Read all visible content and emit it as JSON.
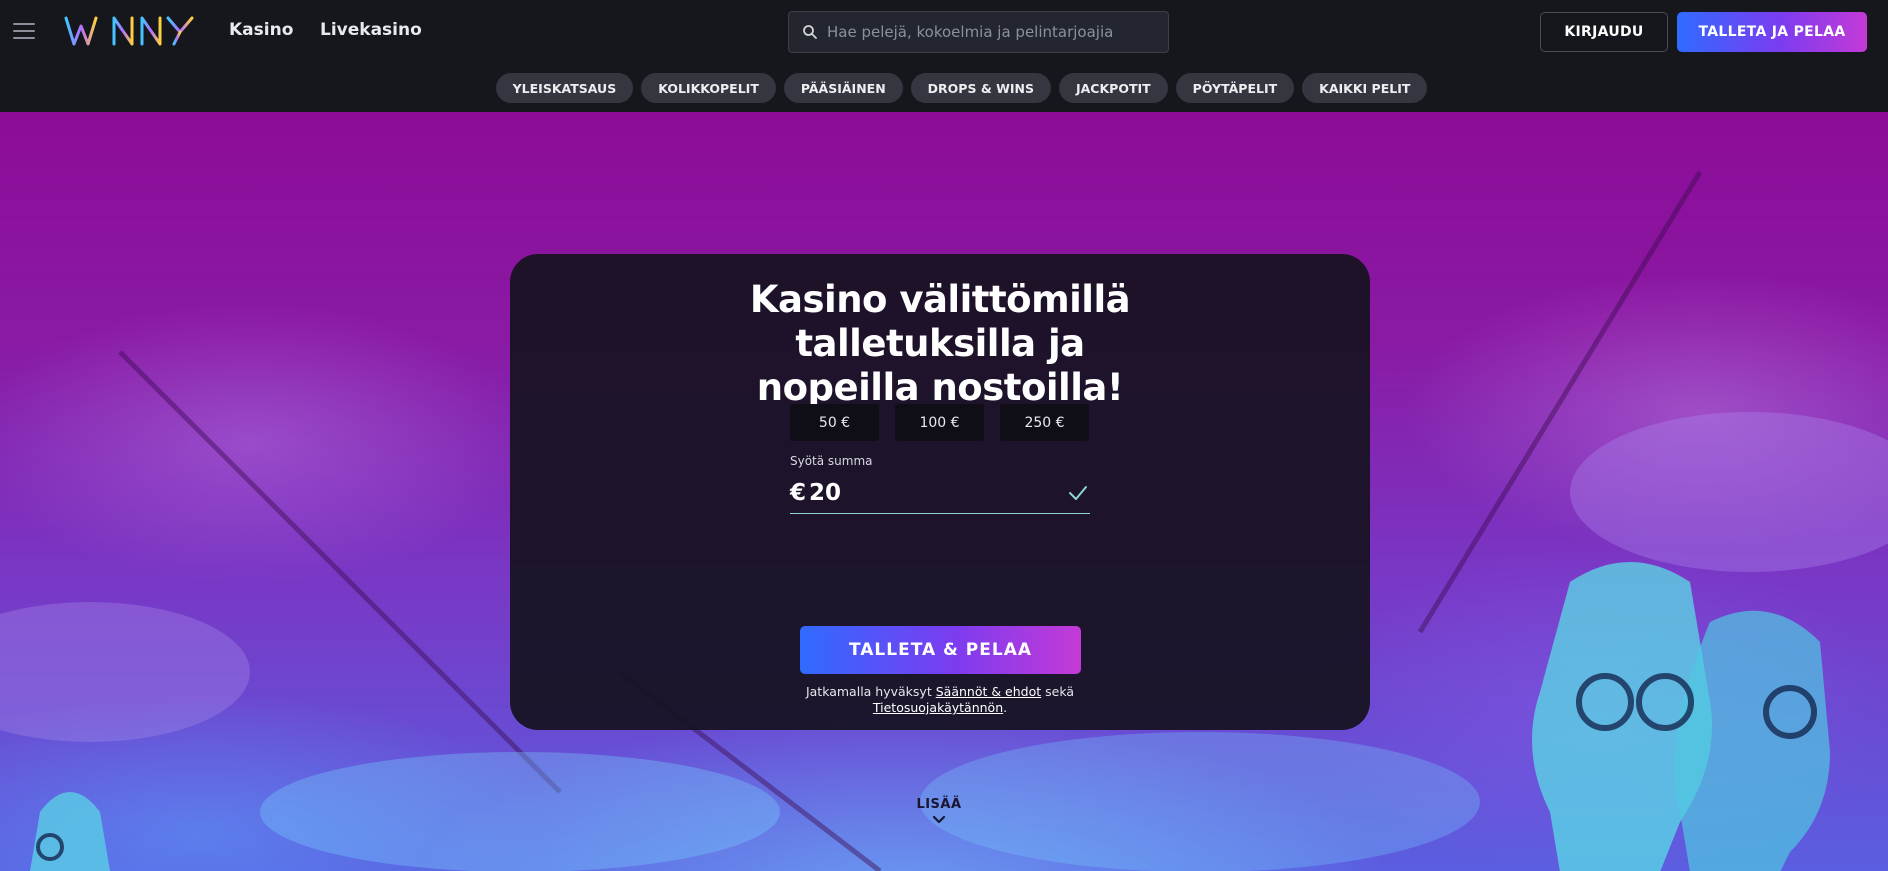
{
  "header": {
    "logo_text": "WINNY",
    "nav": [
      {
        "label": "Kasino"
      },
      {
        "label": "Livekasino"
      }
    ],
    "search": {
      "placeholder": "Hae pelejä, kokoelmia ja pelintarjoajia",
      "value": ""
    },
    "login_label": "KIRJAUDU",
    "deposit_label": "TALLETA JA PELAA"
  },
  "categories": [
    {
      "label": "YLEISKATSAUS"
    },
    {
      "label": "KOLIKKOPELIT"
    },
    {
      "label": "PÄÄSIÄINEN"
    },
    {
      "label": "DROPS & WINS"
    },
    {
      "label": "JACKPOTIT"
    },
    {
      "label": "PÖYTÄPELIT"
    },
    {
      "label": "KAIKKI PELIT"
    }
  ],
  "hero": {
    "headline": [
      "Kasino välittömillä",
      "talletuksilla ja",
      "nopeilla nostoilla!"
    ],
    "amount_options": [
      "50 €",
      "100 €",
      "250 €"
    ],
    "amount_field": {
      "label": "Syötä summa",
      "currency": "€",
      "value": "20"
    },
    "deposit_button": "TALLETA & PELAA",
    "terms": {
      "prefix": "Jatkamalla hyväksyt",
      "link1": "Säännöt & ehdot",
      "middle": "sekä",
      "link2": "Tietosuojakäytännön",
      "suffix": "."
    },
    "more_label": "LISÄÄ"
  },
  "colors": {
    "header_bg": "#15171d",
    "category_pill_bg": "#34373f",
    "hero_purple": "#8c0c97",
    "card_bg": "#16121f",
    "gradient_start": "#2f6bff",
    "gradient_end": "#c43ad6",
    "check_teal": "#8fd6d0"
  },
  "icons": [
    "menu-icon",
    "search-icon",
    "check-icon",
    "chevron-down-icon"
  ]
}
